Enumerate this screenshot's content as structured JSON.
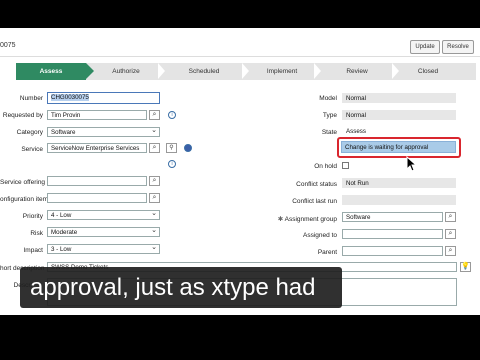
{
  "header": {
    "record_number_partial": "0075",
    "btn1": "Update",
    "btn2": "Resolve"
  },
  "stages": [
    {
      "label": "Assess",
      "active": true
    },
    {
      "label": "Authorize",
      "active": false
    },
    {
      "label": "Scheduled",
      "active": false
    },
    {
      "label": "Implement",
      "active": false
    },
    {
      "label": "Review",
      "active": false
    },
    {
      "label": "Closed",
      "active": false
    }
  ],
  "left": {
    "number_label": "Number",
    "number_value": "CHG0030075",
    "requested_by_label": "Requested by",
    "requested_by_value": "Tim Provin",
    "category_label": "Category",
    "category_value": "Software",
    "service_label": "Service",
    "service_value": "ServiceNow Enterprise Services",
    "service_offering_label": "Service offering",
    "service_offering_value": "",
    "config_item_label": "onfiguration item",
    "priority_label": "Priority",
    "priority_value": "4 - Low",
    "risk_label": "Risk",
    "risk_value": "Moderate",
    "impact_label": "Impact",
    "impact_value": "3 - Low",
    "short_desc_label": "hort description",
    "short_desc_value": "SWSS Demo Tickets",
    "description_label": "Descri"
  },
  "right": {
    "model_label": "Model",
    "model_value": "Normal",
    "type_label": "Type",
    "type_value": "Normal",
    "state_label": "State",
    "state_value": "Assess",
    "state_option": "Change is waiting for approval",
    "on_hold_label": "On hold",
    "conflict_status_label": "Conflict status",
    "conflict_status_value": "Not Run",
    "conflict_last_run_label": "Conflict last run",
    "conflict_last_run_value": "",
    "assignment_group_label": "Assignment group",
    "assignment_group_value": "Software",
    "assigned_to_label": "Assigned to",
    "assigned_to_value": "",
    "parent_label": "Parent",
    "parent_value": ""
  },
  "caption": "approval, just as xtype had",
  "colors": {
    "stage_active": "#2f8a62",
    "highlight_border": "#d9262e",
    "selected_option": "#a9cbe8"
  }
}
